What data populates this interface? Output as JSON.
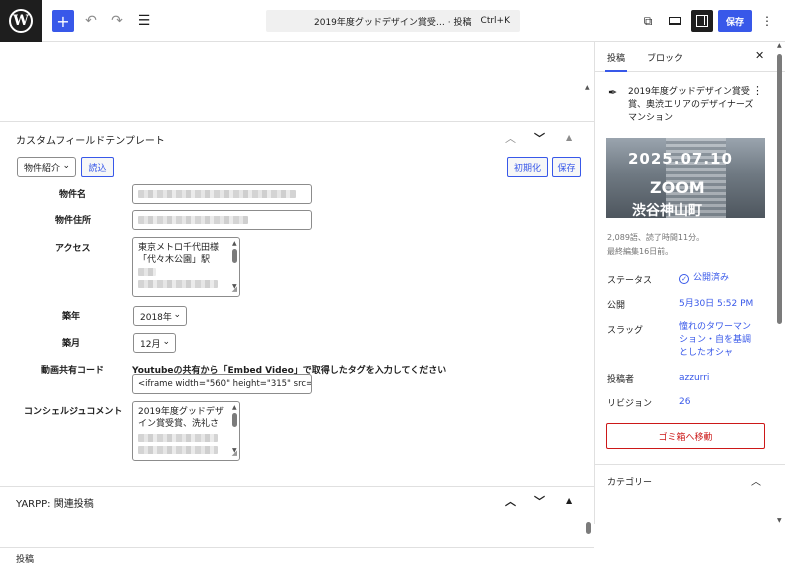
{
  "topbar": {
    "command_title": "2019年度グッドデザイン賞受… · 投稿",
    "shortcut": "Ctrl+K",
    "save_label": "保存"
  },
  "metabox": {
    "title": "カスタムフィールドテンプレート",
    "template_select": "物件紹介",
    "load_button": "読込",
    "init_button": "初期化",
    "save_button": "保存",
    "fields": [
      {
        "label": "物件名"
      },
      {
        "label": "物件住所"
      },
      {
        "label": "アクセス",
        "lines": [
          "東京メトロ千代田様",
          "「代々木公園」駅"
        ]
      },
      {
        "label": "築年",
        "value": "2018年"
      },
      {
        "label": "築月",
        "value": "12月"
      },
      {
        "label": "動画共有コード",
        "hint": "Youtubeの共有から「Embed Video」で取得したタグを入力してください",
        "value": "<iframe width=\"560\" height=\"315\" src="
      },
      {
        "label": "コンシェルジュコメント",
        "lines": [
          "2019年度グッドデザ",
          "イン賞受賞、洗礼さ"
        ]
      }
    ]
  },
  "yarpp": {
    "title": "YARPP: 関連投稿"
  },
  "footer": {
    "breadcrumb": "投稿"
  },
  "sidebar": {
    "tabs": [
      "投稿",
      "ブロック"
    ],
    "post_title": "2019年度グッドデザイン賞受賞、奥渋エリアのデザイナーズマンション",
    "image_text": {
      "date": "2025.07.10",
      "zoom": "ZOOM",
      "jp": "渋谷神山町"
    },
    "word_count": "2,089語、読了時間11分。",
    "last_edited": "最終編集16日前。",
    "rows": [
      {
        "label": "ステータス",
        "value": "公開済み"
      },
      {
        "label": "公開",
        "value": "5月30日 5:52 PM"
      },
      {
        "label": "スラッグ",
        "value": "憧れのタワーマンション・自を基調としたオシャ"
      },
      {
        "label": "投稿者",
        "value": "azzurri"
      },
      {
        "label": "リビジョン",
        "value": "26"
      }
    ],
    "trash_label": "ゴミ箱へ移動",
    "category_label": "カテゴリー"
  },
  "colors": {
    "accent": "#3858e9",
    "danger": "#cc1818",
    "dark": "#1e1e1e"
  }
}
